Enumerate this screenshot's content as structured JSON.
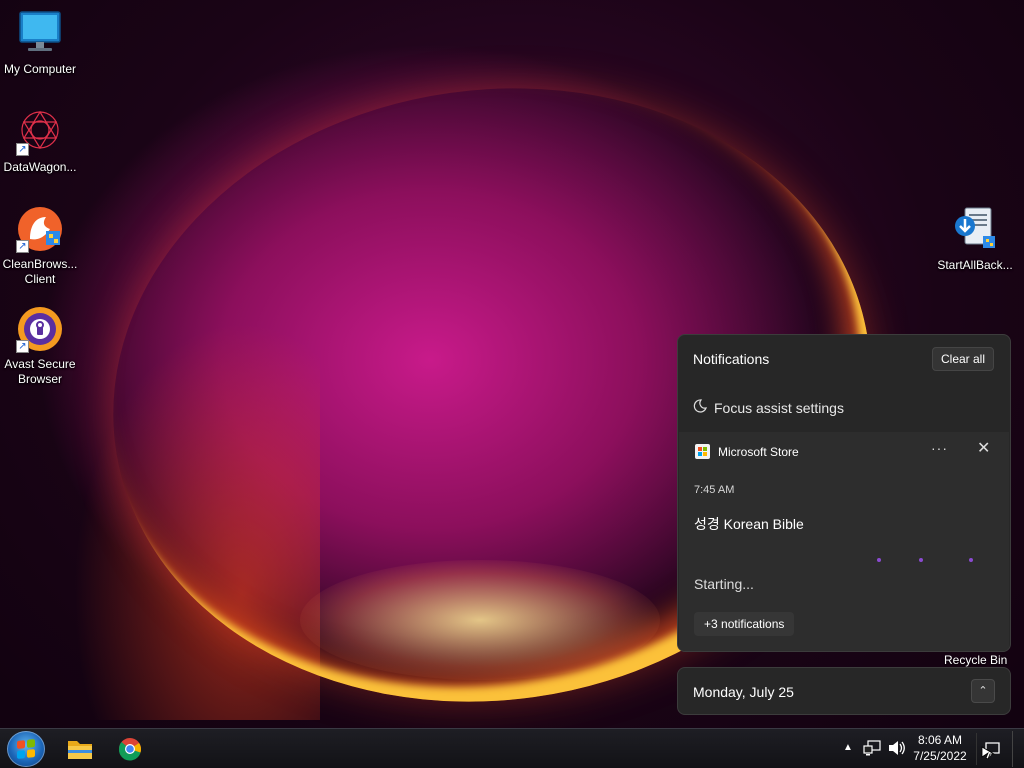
{
  "desktop": {
    "icons_left": [
      {
        "label": "My Computer",
        "icon": "monitor-icon"
      },
      {
        "label": "DataWagon...",
        "icon": "datawagon-icon"
      },
      {
        "label": "CleanBrows...\nClient",
        "icon": "cleanbrowsing-icon"
      },
      {
        "label": "Avast Secure\nBrowser",
        "icon": "avast-browser-icon"
      }
    ],
    "icons_right": [
      {
        "label": "StartAllBack...",
        "icon": "startallback-icon"
      }
    ],
    "recycle_bin_label": "Recycle Bin"
  },
  "notifications": {
    "title": "Notifications",
    "clear_all": "Clear all",
    "focus_assist": "Focus assist settings",
    "toast": {
      "app": "Microsoft Store",
      "more": "···",
      "close": "✕",
      "time": "7:45 AM",
      "title": "성경 Korean Bible",
      "status": "Starting..."
    },
    "more_notifications": "+3 notifications"
  },
  "calendar": {
    "date": "Monday, July 25",
    "toggle": "⌃"
  },
  "taskbar": {
    "pinned": [
      "file-explorer-icon",
      "chrome-icon"
    ],
    "tray_chevron": "▲",
    "clock_time": "8:06 AM",
    "clock_date": "7/25/2022"
  },
  "colors": {
    "panel_bg": "#272727",
    "toast_bg": "#2d2d2d",
    "accent_purple": "#8a4bd0"
  }
}
